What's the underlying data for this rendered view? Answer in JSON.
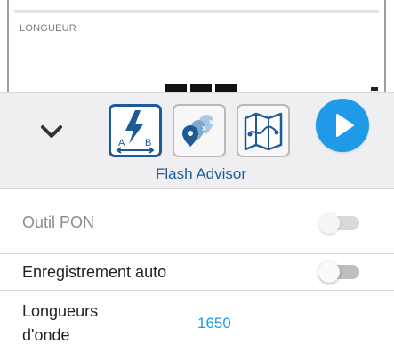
{
  "card": {
    "label": "LONGUEUR"
  },
  "toolbar": {
    "tools": [
      {
        "name": "Flash Advisor",
        "icon": "flash-ab-icon",
        "active": true
      },
      {
        "name": "",
        "icon": "location-pins-icon",
        "active": false
      },
      {
        "name": "",
        "icon": "map-route-icon",
        "active": false
      }
    ],
    "active_tool_caption": "Flash Advisor",
    "collapse_icon": "chevron-down-icon",
    "start_icon": "play-icon"
  },
  "settings": [
    {
      "label": "Outil PON",
      "enabled": false,
      "toggle_on": false
    },
    {
      "label": "Enregistrement auto",
      "enabled": true,
      "toggle_on": false
    },
    {
      "label_line1": "Longueurs",
      "label_line2": "d'onde",
      "value": "1650"
    }
  ],
  "colors": {
    "accent_dark_blue": "#1e5b96",
    "accent_light_blue": "#1f9ae8",
    "toolbar_bg": "#efeff1"
  }
}
